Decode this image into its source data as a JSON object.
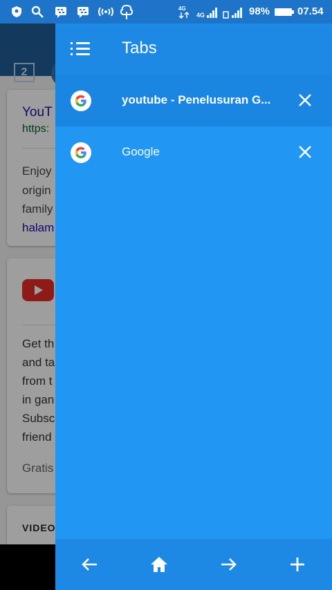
{
  "status_bar": {
    "battery_percent": "98%",
    "time": "07.54",
    "network": "4G"
  },
  "background_page": {
    "tab_count": "2",
    "card1": {
      "title": "YouT",
      "url": "https:",
      "lines": [
        "Enjoy",
        "origin",
        "family",
        "halam"
      ]
    },
    "card2": {
      "lines": [
        "Get th",
        "and ta",
        "from t",
        "in gan",
        "Subsc",
        "friend"
      ],
      "footer": "Gratis"
    },
    "card3": {
      "heading": "VIDEO"
    }
  },
  "drawer": {
    "title": "Tabs",
    "tabs": [
      {
        "label": "youtube - Penelusuran G...",
        "selected": true
      },
      {
        "label": "Google",
        "selected": false
      }
    ],
    "footer_buttons": [
      "back-arrow-icon",
      "home-icon",
      "forward-arrow-icon",
      "plus-icon"
    ]
  },
  "colors": {
    "drawer_bg": "#2196f3",
    "drawer_header": "#1e88e5",
    "selected_tab": "#1b86e2",
    "status_bar": "#1d74c8"
  }
}
